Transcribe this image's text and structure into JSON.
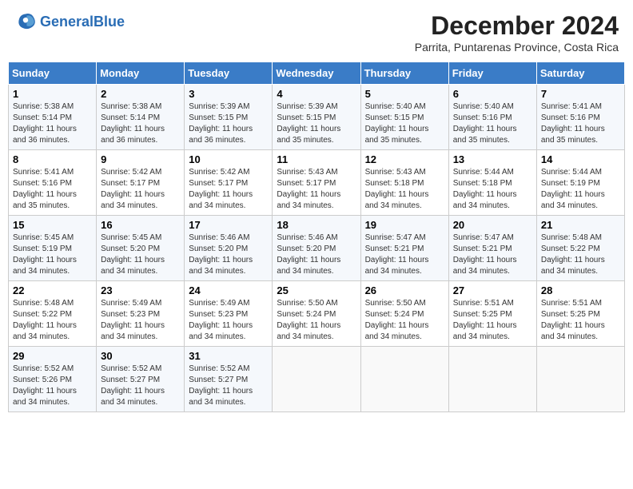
{
  "header": {
    "logo_line1": "General",
    "logo_line2": "Blue",
    "month_title": "December 2024",
    "subtitle": "Parrita, Puntarenas Province, Costa Rica"
  },
  "weekdays": [
    "Sunday",
    "Monday",
    "Tuesday",
    "Wednesday",
    "Thursday",
    "Friday",
    "Saturday"
  ],
  "weeks": [
    [
      {
        "day": "1",
        "sunrise": "5:38 AM",
        "sunset": "5:14 PM",
        "daylight": "11 hours and 36 minutes."
      },
      {
        "day": "2",
        "sunrise": "5:38 AM",
        "sunset": "5:14 PM",
        "daylight": "11 hours and 36 minutes."
      },
      {
        "day": "3",
        "sunrise": "5:39 AM",
        "sunset": "5:15 PM",
        "daylight": "11 hours and 36 minutes."
      },
      {
        "day": "4",
        "sunrise": "5:39 AM",
        "sunset": "5:15 PM",
        "daylight": "11 hours and 35 minutes."
      },
      {
        "day": "5",
        "sunrise": "5:40 AM",
        "sunset": "5:15 PM",
        "daylight": "11 hours and 35 minutes."
      },
      {
        "day": "6",
        "sunrise": "5:40 AM",
        "sunset": "5:16 PM",
        "daylight": "11 hours and 35 minutes."
      },
      {
        "day": "7",
        "sunrise": "5:41 AM",
        "sunset": "5:16 PM",
        "daylight": "11 hours and 35 minutes."
      }
    ],
    [
      {
        "day": "8",
        "sunrise": "5:41 AM",
        "sunset": "5:16 PM",
        "daylight": "11 hours and 35 minutes."
      },
      {
        "day": "9",
        "sunrise": "5:42 AM",
        "sunset": "5:17 PM",
        "daylight": "11 hours and 34 minutes."
      },
      {
        "day": "10",
        "sunrise": "5:42 AM",
        "sunset": "5:17 PM",
        "daylight": "11 hours and 34 minutes."
      },
      {
        "day": "11",
        "sunrise": "5:43 AM",
        "sunset": "5:17 PM",
        "daylight": "11 hours and 34 minutes."
      },
      {
        "day": "12",
        "sunrise": "5:43 AM",
        "sunset": "5:18 PM",
        "daylight": "11 hours and 34 minutes."
      },
      {
        "day": "13",
        "sunrise": "5:44 AM",
        "sunset": "5:18 PM",
        "daylight": "11 hours and 34 minutes."
      },
      {
        "day": "14",
        "sunrise": "5:44 AM",
        "sunset": "5:19 PM",
        "daylight": "11 hours and 34 minutes."
      }
    ],
    [
      {
        "day": "15",
        "sunrise": "5:45 AM",
        "sunset": "5:19 PM",
        "daylight": "11 hours and 34 minutes."
      },
      {
        "day": "16",
        "sunrise": "5:45 AM",
        "sunset": "5:20 PM",
        "daylight": "11 hours and 34 minutes."
      },
      {
        "day": "17",
        "sunrise": "5:46 AM",
        "sunset": "5:20 PM",
        "daylight": "11 hours and 34 minutes."
      },
      {
        "day": "18",
        "sunrise": "5:46 AM",
        "sunset": "5:20 PM",
        "daylight": "11 hours and 34 minutes."
      },
      {
        "day": "19",
        "sunrise": "5:47 AM",
        "sunset": "5:21 PM",
        "daylight": "11 hours and 34 minutes."
      },
      {
        "day": "20",
        "sunrise": "5:47 AM",
        "sunset": "5:21 PM",
        "daylight": "11 hours and 34 minutes."
      },
      {
        "day": "21",
        "sunrise": "5:48 AM",
        "sunset": "5:22 PM",
        "daylight": "11 hours and 34 minutes."
      }
    ],
    [
      {
        "day": "22",
        "sunrise": "5:48 AM",
        "sunset": "5:22 PM",
        "daylight": "11 hours and 34 minutes."
      },
      {
        "day": "23",
        "sunrise": "5:49 AM",
        "sunset": "5:23 PM",
        "daylight": "11 hours and 34 minutes."
      },
      {
        "day": "24",
        "sunrise": "5:49 AM",
        "sunset": "5:23 PM",
        "daylight": "11 hours and 34 minutes."
      },
      {
        "day": "25",
        "sunrise": "5:50 AM",
        "sunset": "5:24 PM",
        "daylight": "11 hours and 34 minutes."
      },
      {
        "day": "26",
        "sunrise": "5:50 AM",
        "sunset": "5:24 PM",
        "daylight": "11 hours and 34 minutes."
      },
      {
        "day": "27",
        "sunrise": "5:51 AM",
        "sunset": "5:25 PM",
        "daylight": "11 hours and 34 minutes."
      },
      {
        "day": "28",
        "sunrise": "5:51 AM",
        "sunset": "5:25 PM",
        "daylight": "11 hours and 34 minutes."
      }
    ],
    [
      {
        "day": "29",
        "sunrise": "5:52 AM",
        "sunset": "5:26 PM",
        "daylight": "11 hours and 34 minutes."
      },
      {
        "day": "30",
        "sunrise": "5:52 AM",
        "sunset": "5:27 PM",
        "daylight": "11 hours and 34 minutes."
      },
      {
        "day": "31",
        "sunrise": "5:52 AM",
        "sunset": "5:27 PM",
        "daylight": "11 hours and 34 minutes."
      },
      null,
      null,
      null,
      null
    ]
  ],
  "labels": {
    "sunrise": "Sunrise:",
    "sunset": "Sunset:",
    "daylight": "Daylight:"
  }
}
